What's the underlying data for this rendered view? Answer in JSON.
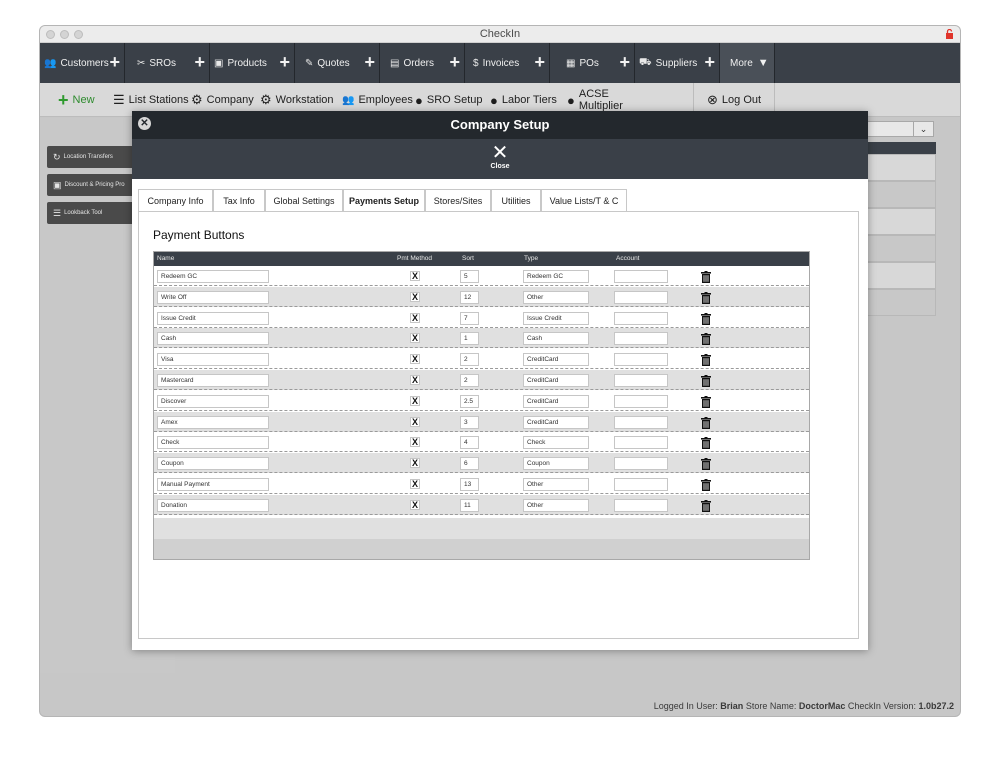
{
  "window": {
    "title": "CheckIn"
  },
  "nav": {
    "items": [
      {
        "label": "Customers",
        "icon": "users-icon",
        "has_plus": true
      },
      {
        "label": "SROs",
        "icon": "tools-icon",
        "has_plus": true
      },
      {
        "label": "Products",
        "icon": "box-icon",
        "has_plus": true
      },
      {
        "label": "Quotes",
        "icon": "edit-icon",
        "has_plus": true
      },
      {
        "label": "Orders",
        "icon": "clipboard-icon",
        "has_plus": true
      },
      {
        "label": "Invoices",
        "icon": "dollar-icon",
        "has_plus": true
      },
      {
        "label": "POs",
        "icon": "calculator-icon",
        "has_plus": true
      },
      {
        "label": "Suppliers",
        "icon": "truck-icon",
        "has_plus": true
      },
      {
        "label": "More",
        "icon": "caret-down-icon",
        "has_plus": false
      }
    ],
    "plus_glyph": "+",
    "more_caret": "▼"
  },
  "subnav": {
    "new_label": "New",
    "list_stations": "List Stations",
    "company": "Company",
    "workstation": "Workstation",
    "employees": "Employees",
    "sro_setup": "SRO Setup",
    "labor_tiers": "Labor Tiers",
    "acse_line1": "ACSE",
    "acse_line2": "Multiplier",
    "logout": "Log Out"
  },
  "sidebar": {
    "buttons": [
      "Location Transfers",
      "Discount & Pricing Pro",
      "Lookback Tool"
    ]
  },
  "footer": {
    "logged_in_prefix": "Logged In User:",
    "user": "Brian",
    "store_prefix": "Store Name:",
    "store": "DoctorMac",
    "version_prefix": "CheckIn Version:",
    "version": "1.0b27.2"
  },
  "modal": {
    "title": "Company Setup",
    "close_label": "Close",
    "close_glyph": "✕",
    "tabs": [
      "Company Info",
      "Tax Info",
      "Global Settings",
      "Payments Setup",
      "Stores/Sites",
      "Utilities",
      "Value Lists/T & C"
    ],
    "active_tab": "Payments Setup",
    "section_title": "Payment Buttons",
    "columns": {
      "name": "Name",
      "pmt_method": "Pmt Method",
      "sort": "Sort",
      "type": "Type",
      "account": "Account"
    },
    "rows": [
      {
        "name": "Redeem GC",
        "pmt": "X",
        "sort": "5",
        "type": "Redeem GC",
        "account": ""
      },
      {
        "name": "Write Off",
        "pmt": "X",
        "sort": "12",
        "type": "Other",
        "account": ""
      },
      {
        "name": "Issue Credit",
        "pmt": "X",
        "sort": "7",
        "type": "Issue Credit",
        "account": ""
      },
      {
        "name": "Cash",
        "pmt": "X",
        "sort": "1",
        "type": "Cash",
        "account": ""
      },
      {
        "name": "Visa",
        "pmt": "X",
        "sort": "2",
        "type": "CreditCard",
        "account": ""
      },
      {
        "name": "Mastercard",
        "pmt": "X",
        "sort": "2",
        "type": "CreditCard",
        "account": ""
      },
      {
        "name": "Discover",
        "pmt": "X",
        "sort": "2.5",
        "type": "CreditCard",
        "account": ""
      },
      {
        "name": "Amex",
        "pmt": "X",
        "sort": "3",
        "type": "CreditCard",
        "account": ""
      },
      {
        "name": "Check",
        "pmt": "X",
        "sort": "4",
        "type": "Check",
        "account": ""
      },
      {
        "name": "Coupon",
        "pmt": "X",
        "sort": "6",
        "type": "Coupon",
        "account": ""
      },
      {
        "name": "Manual Payment",
        "pmt": "X",
        "sort": "13",
        "type": "Other",
        "account": ""
      },
      {
        "name": "Donation",
        "pmt": "X",
        "sort": "11",
        "type": "Other",
        "account": ""
      },
      {
        "name": "",
        "pmt": "",
        "sort": "",
        "type": "",
        "account": ""
      }
    ]
  },
  "colors": {
    "navbar": "#3a4048",
    "modal_header": "#23282d",
    "new_green": "#2e9a2e",
    "row_stripe": "#e0e0e0"
  }
}
